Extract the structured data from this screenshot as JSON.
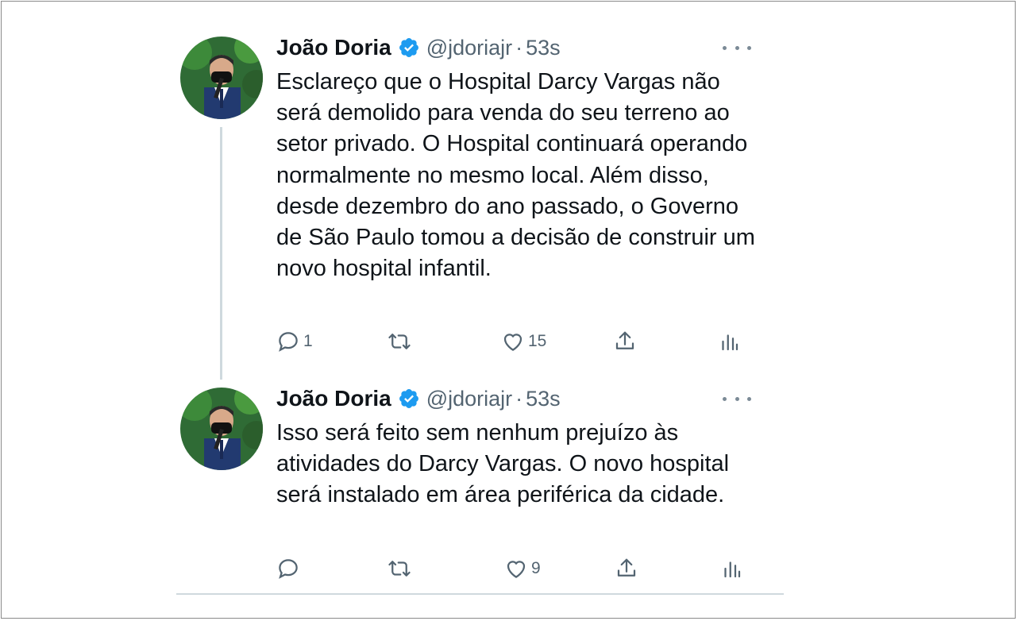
{
  "tweets": [
    {
      "author_name": "João Doria",
      "handle": "@jdoriajr",
      "separator": "·",
      "time": "53s",
      "text": "Esclareço que o Hospital Darcy Vargas não será demolido para venda do seu terreno ao setor privado. O Hospital continuará operando normalmente no mesmo local. Além disso, desde dezembro do ano passado, o Governo de São Paulo tomou a decisão de construir um novo hospital infantil.",
      "reply_count": "1",
      "retweet_count": "",
      "like_count": "15"
    },
    {
      "author_name": "João Doria",
      "handle": "@jdoriajr",
      "separator": "·",
      "time": "53s",
      "text": "Isso será feito sem nenhum prejuízo às atividades do Darcy Vargas. O novo hospital será instalado em área periférica da cidade.",
      "reply_count": "",
      "retweet_count": "",
      "like_count": "9"
    }
  ],
  "icons": {
    "reply": "reply-icon",
    "retweet": "retweet-icon",
    "like": "heart-icon",
    "share": "share-icon",
    "analytics": "analytics-icon",
    "verified": "verified-badge-icon",
    "more": "more-options-icon"
  },
  "colors": {
    "verified_blue": "#1d9bf0",
    "text_primary": "#0f1419",
    "text_secondary": "#536471",
    "thread_line": "#cfd9de"
  }
}
